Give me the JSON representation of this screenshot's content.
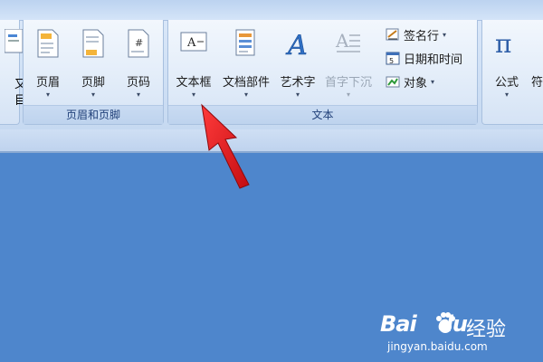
{
  "ribbon": {
    "groups": {
      "header_footer": {
        "label": "页眉和页脚",
        "buttons": {
          "header": "页眉",
          "footer": "页脚",
          "page_number": "页码"
        }
      },
      "text": {
        "label": "文本",
        "buttons": {
          "text_box": "文本框",
          "quick_parts": "文档部件",
          "wordart": "艺术字",
          "drop_cap": "首字下沉"
        },
        "small_buttons": {
          "signature_line": "签名行",
          "date_time": "日期和时间",
          "object": "对象"
        }
      },
      "symbols": {
        "buttons": {
          "equation": "公式"
        },
        "partial_label": "符"
      },
      "left_cut": {
        "lines": [
          "又",
          "目"
        ]
      }
    },
    "dropdown_glyph": "▾"
  },
  "watermark": {
    "logo": "Bai",
    "logo_suffix": "du",
    "cn": "经验",
    "url": "jingyan.baidu.com"
  },
  "colors": {
    "document_bg": "#4e86cc",
    "arrow": "#e3151a",
    "group_label_text": "#1f3f78"
  }
}
